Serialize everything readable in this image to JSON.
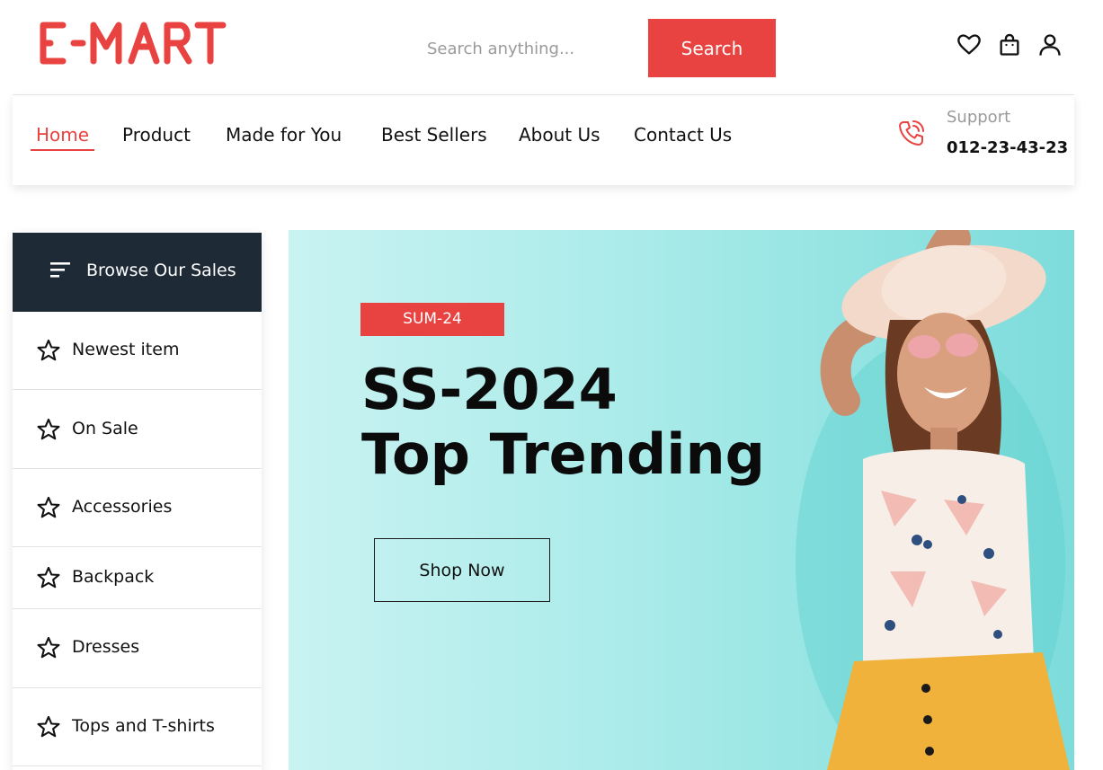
{
  "brand": {
    "name": "E-MART",
    "color": "#e84340"
  },
  "search": {
    "placeholder": "Search anything...",
    "button_label": "Search"
  },
  "header_icons": [
    "heart-icon",
    "shopping-bag-icon",
    "user-icon"
  ],
  "nav": {
    "items": [
      {
        "label": "Home",
        "active": true
      },
      {
        "label": "Product",
        "active": false
      },
      {
        "label": "Made for You",
        "active": false
      },
      {
        "label": "Best Sellers",
        "active": false
      },
      {
        "label": "About Us",
        "active": false
      },
      {
        "label": "Contact Us",
        "active": false
      }
    ],
    "support_label": "Support",
    "support_phone": "012-23-43-23"
  },
  "sidebar": {
    "header": "Browse Our Sales",
    "items": [
      {
        "label": "Newest item"
      },
      {
        "label": "On Sale"
      },
      {
        "label": "Accessories"
      },
      {
        "label": "Backpack"
      },
      {
        "label": "Dresses"
      },
      {
        "label": "Tops and T-shirts"
      }
    ]
  },
  "hero": {
    "tag": "SUM-24",
    "title_line1": "SS-2024",
    "title_line2": "Top Trending",
    "cta": "Shop Now"
  },
  "colors": {
    "accent": "#e84340",
    "dark": "#1e2a36",
    "hero_bg": "#a9ebe9"
  }
}
